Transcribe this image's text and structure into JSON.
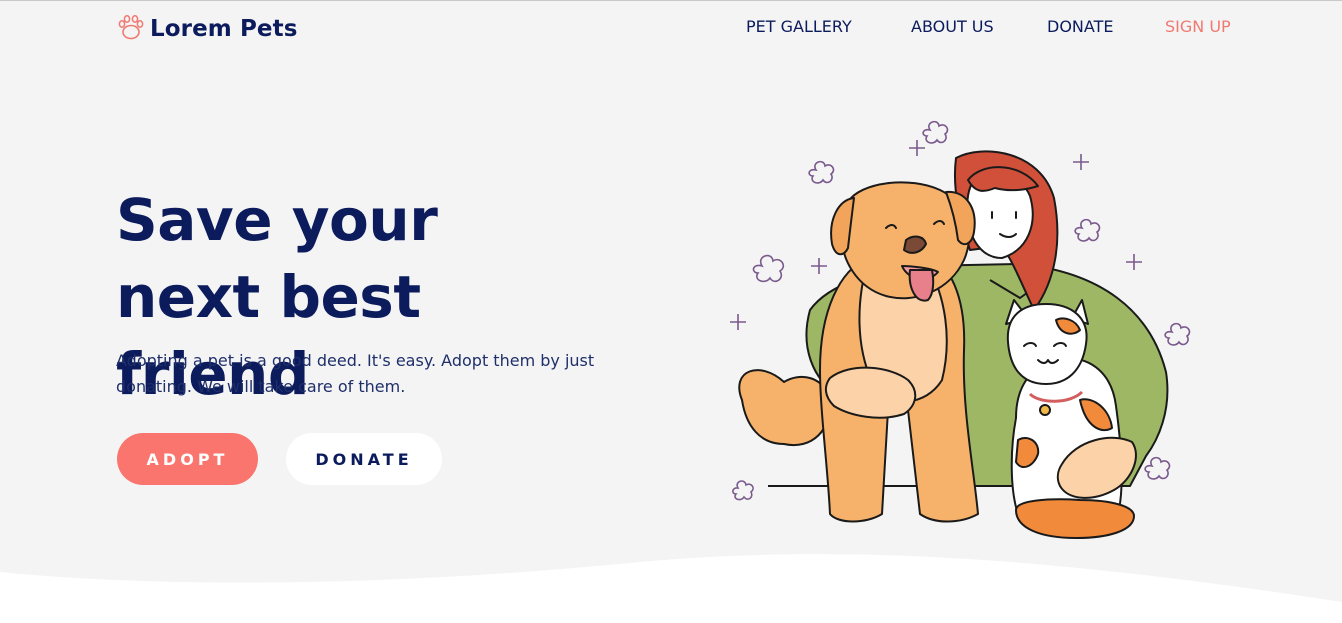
{
  "brand": {
    "name": "Lorem Pets",
    "logo_icon": "paw-icon"
  },
  "nav": {
    "items": [
      {
        "label": "PET GALLERY"
      },
      {
        "label": "ABOUT US"
      },
      {
        "label": "DONATE"
      }
    ],
    "signup_label": "SIGN UP"
  },
  "hero": {
    "title": "Save your next best friend",
    "subtitle": "Adopting a pet is a good deed. It's easy. Adopt them by just donating. We will take care of them.",
    "adopt_label": "ADOPT",
    "donate_label": "DONATE",
    "illustration": "woman-hugging-dog-and-cat-illustration"
  },
  "colors": {
    "navy": "#0b1b5c",
    "accent": "#f9756e",
    "background": "#f4f4f5",
    "white": "#ffffff"
  }
}
